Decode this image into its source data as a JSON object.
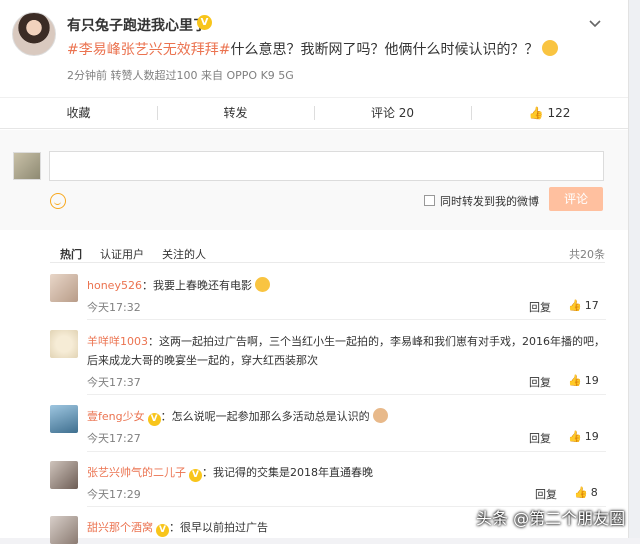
{
  "post": {
    "username": "有只兔子跑进我心里了",
    "verified_badge": "V",
    "more_icon": "chevron-down-icon",
    "hashtag": "#李易峰张艺兴无效拜拜#",
    "text": "什么意思？我断网了吗？他俩什么时候认识的？？",
    "meta": "2分钟前  转赞人数超过100  来自 OPPO K9 5G"
  },
  "actions": {
    "favorite": "收藏",
    "repost": "转发",
    "comment": "评论 20",
    "like": "122"
  },
  "composer": {
    "input_value": "",
    "forward_label": "同时转发到我的微博",
    "submit": "评论"
  },
  "filters": {
    "hot": "热门",
    "verified": "认证用户",
    "following": "关注的人",
    "total": "共20条"
  },
  "comments": [
    {
      "name": "honey526",
      "text": "：我要上春晚还有电影",
      "time": "今天17:32",
      "reply": "回复",
      "likes": "17"
    },
    {
      "name": "羊咩咩1003",
      "text": "：这两一起拍过广告啊，三个当红小生一起拍的，李易峰和我们崽有对手戏，2016年播的吧，",
      "text2": "后来成龙大哥的晚宴坐一起的，穿大红西装那次",
      "time": "今天17:37",
      "reply": "回复",
      "likes": "19"
    },
    {
      "name": "壹feng少女",
      "text": "：怎么说呢一起参加那么多活动总是认识的",
      "time": "今天17:27",
      "reply": "回复",
      "likes": "19"
    },
    {
      "name": "张艺兴帅气的二儿子",
      "text": "：我记得的交集是2018年直通春晚",
      "time": "今天17:29",
      "reply": "回复",
      "likes": "8"
    },
    {
      "name": "甜兴那个酒窝",
      "text": "：很早以前拍过广告"
    }
  ],
  "watermark": "头条 @第二个朋友圈",
  "colors": {
    "accent": "#eb7350",
    "badge": "#f8c51b",
    "submit_disabled": "#ffc09f"
  }
}
